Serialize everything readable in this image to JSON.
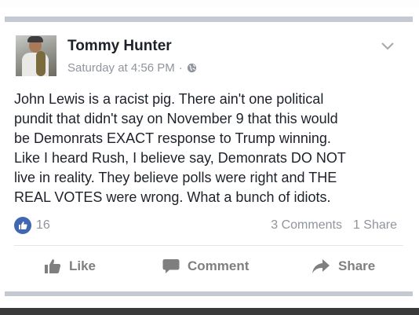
{
  "post": {
    "author": "Tommy Hunter",
    "timestamp": "Saturday at 4:56 PM",
    "separator": "·",
    "privacy_icon": "globe-icon",
    "text": "John Lewis is a racist pig.  There ain't one political\npundit that didn't say on November 9 that this would\nbe Demonrats EXACT response to Trump winning.\nLike I heard Rush, I believe say, Demonrats DO NOT\nlive in reality. They believe polls were right and THE\nREAL VOTES were wrong. What a bunch of idiots.",
    "options_icon": "chevron-down-icon"
  },
  "stats": {
    "likes": "16",
    "comments": "3 Comments",
    "shares": "1 Share"
  },
  "actions": {
    "like": "Like",
    "comment": "Comment",
    "share": "Share"
  },
  "colors": {
    "facebook_blue": "#4267b2",
    "text": "#1d2129",
    "muted": "#90949c",
    "action": "#7f7f7f"
  }
}
